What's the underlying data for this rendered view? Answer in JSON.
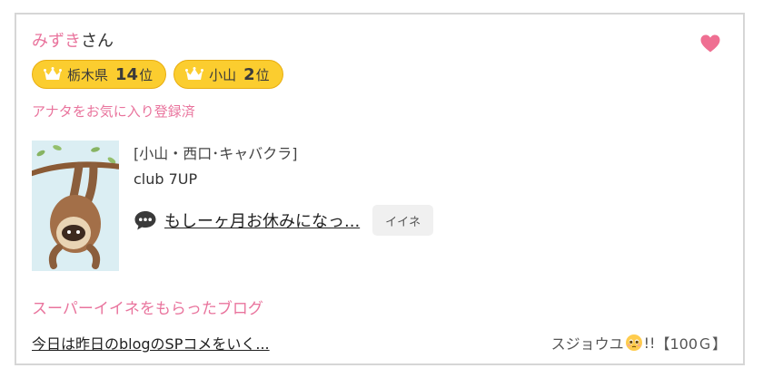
{
  "profile": {
    "name": "みずき",
    "suffix": "さん",
    "favorite_status": "アナタをお気に入り登録済"
  },
  "badges": [
    {
      "area": "栃木県",
      "rank": "14",
      "unit": "位"
    },
    {
      "area": "小山",
      "rank": "2",
      "unit": "位"
    }
  ],
  "shop": {
    "area": "[小山・西口･キャバクラ]",
    "name": "club 7UP",
    "latest_message": "もしーヶ月お休みになっ...",
    "iine_label": "イイネ"
  },
  "super_iine": {
    "title": "スーパーイイネをもらったブログ",
    "blog_title": "今日は昨日のblogのSPコメをいく...",
    "sender": "スジョウユ",
    "bang": "!!",
    "points": "【100Ｇ】"
  },
  "colors": {
    "pink": "#e9749d",
    "badge_yellow": "#fbcd2f",
    "border": "#d6d6d6"
  },
  "icons": {
    "heart": "heart-icon",
    "crown": "crown-icon",
    "chat": "chat-bubble-icon",
    "emoji": "pleading-face-emoji"
  }
}
